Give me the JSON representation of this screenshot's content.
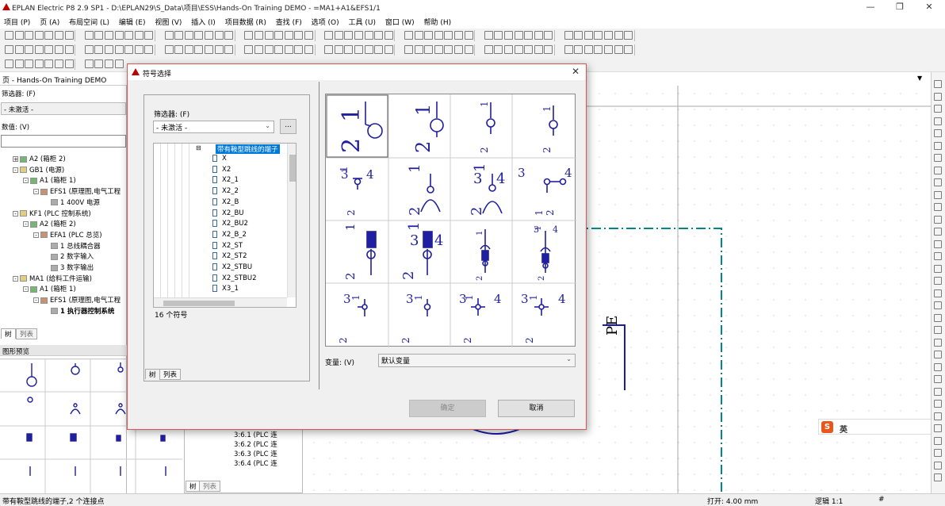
{
  "window": {
    "title": "EPLAN Electric P8 2.9 SP1 - D:\\EPLAN29\\S_Data\\项目\\ESS\\Hands-On Training DEMO - =MA1+A1&EFS1/1",
    "controls": [
      "—",
      "❐",
      "✕"
    ]
  },
  "menu": [
    "项目 (P)",
    "页 (A)",
    "布局空间 (L)",
    "编辑 (E)",
    "视图 (V)",
    "插入 (I)",
    "项目数据 (R)",
    "查找 (F)",
    "选项 (O)",
    "工具 (U)",
    "窗口 (W)",
    "帮助 (H)"
  ],
  "page_panel": {
    "title": "页 - Hands-On Training DEMO",
    "filter_label": "筛选器: (F)",
    "filter_value": "- 未激活 -",
    "value_label": "数值: (V)",
    "tree": [
      {
        "label": "A2 (箱柜 2)",
        "indent": 0,
        "exp": "+",
        "icon": "green"
      },
      {
        "label": "GB1 (电源)",
        "indent": 0,
        "exp": "-",
        "icon": "yellow"
      },
      {
        "label": "A1 (箱柜 1)",
        "indent": 1,
        "exp": "-",
        "icon": "green"
      },
      {
        "label": "EFS1 (原理图,电气工程",
        "indent": 2,
        "exp": "-",
        "icon": "amp"
      },
      {
        "label": "1 400V 电源",
        "indent": 3,
        "exp": "",
        "icon": "page"
      },
      {
        "label": "KF1 (PLC 控制系统)",
        "indent": 0,
        "exp": "-",
        "icon": "yellow"
      },
      {
        "label": "A2 (箱柜 2)",
        "indent": 1,
        "exp": "-",
        "icon": "green"
      },
      {
        "label": "EFA1 (PLC 总览)",
        "indent": 2,
        "exp": "-",
        "icon": "amp"
      },
      {
        "label": "1 总线耦合器",
        "indent": 3,
        "exp": "",
        "icon": "page"
      },
      {
        "label": "2 数字输入",
        "indent": 3,
        "exp": "",
        "icon": "page"
      },
      {
        "label": "3 数字输出",
        "indent": 3,
        "exp": "",
        "icon": "page"
      },
      {
        "label": "MA1 (给料工件运输)",
        "indent": 0,
        "exp": "-",
        "icon": "yellow"
      },
      {
        "label": "A1 (箱柜 1)",
        "indent": 1,
        "exp": "-",
        "icon": "green"
      },
      {
        "label": "EFS1 (原理图,电气工程",
        "indent": 2,
        "exp": "-",
        "icon": "amp"
      },
      {
        "label": "1 执行器控制系统",
        "indent": 3,
        "exp": "",
        "icon": "page",
        "bold": true
      }
    ],
    "tabs": [
      "树",
      "列表"
    ]
  },
  "preview_panel": {
    "title": "图形预览"
  },
  "bottom_panel": {
    "items": [
      "3:6.1 (PLC 连",
      "3:6.2 (PLC 连",
      "3:6.3 (PLC 连",
      "3:6.4 (PLC 连"
    ],
    "tabs": [
      "树",
      "列表"
    ]
  },
  "canvas": {
    "pe_label": "PE"
  },
  "ime": {
    "label": "英"
  },
  "dialog": {
    "title": "符号选择",
    "filter_label": "筛选器: (F)",
    "filter_value": "- 未激活 -",
    "ellipsis": "...",
    "tree_root": "带有鞍型跳线的端子",
    "tree_items": [
      "X",
      "X2",
      "X2_1",
      "X2_2",
      "X2_B",
      "X2_BU",
      "X2_BU2",
      "X2_B_2",
      "X2_ST",
      "X2_ST2",
      "X2_STBU",
      "X2_STBU2",
      "X3_1"
    ],
    "count": "16 个符号",
    "tabs": [
      "树",
      "列表"
    ],
    "variant_label": "变量: (V)",
    "variant_value": "默认变量",
    "ok": "确定",
    "cancel": "取消"
  },
  "status": {
    "left": "带有鞍型跳线的端子,2 个连接点",
    "grid": "打开: 4.00 mm",
    "logic": "逻辑 1:1",
    "hash": "#"
  },
  "colors": {
    "symbol": "#1f1f9f",
    "teal": "#00868b",
    "navy": "#1a1aa8",
    "selected": "#0078d7",
    "dialog_border": "#dd5555"
  }
}
